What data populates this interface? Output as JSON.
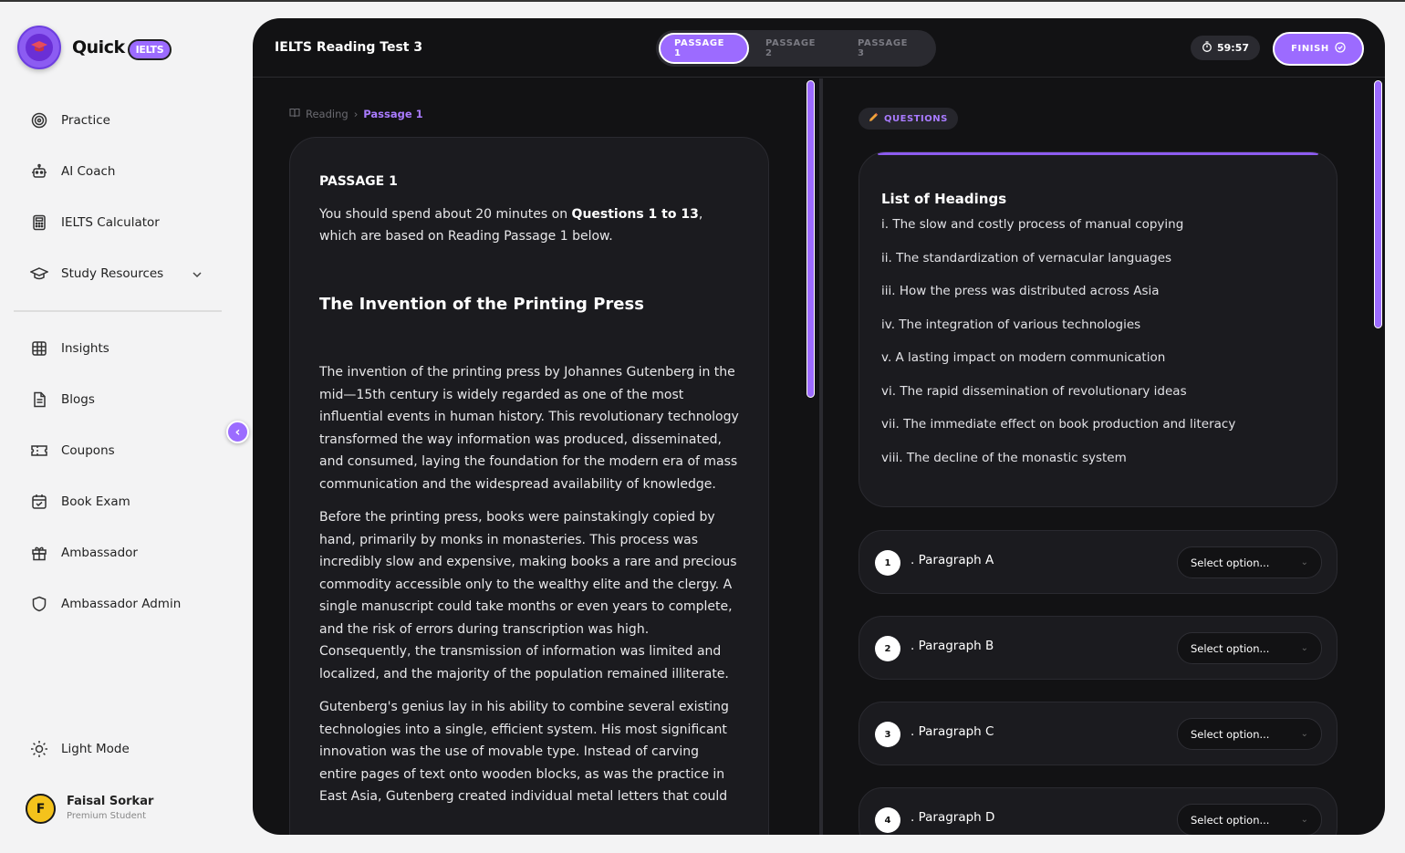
{
  "brand": {
    "name": "Quick",
    "badge": "IELTS"
  },
  "sidebar": {
    "items": [
      {
        "label": "Practice",
        "icon": "target-icon"
      },
      {
        "label": "AI Coach",
        "icon": "robot-icon"
      },
      {
        "label": "IELTS Calculator",
        "icon": "calculator-icon"
      },
      {
        "label": "Study Resources",
        "icon": "graduation-cap-icon"
      },
      {
        "label": "Insights",
        "icon": "grid-icon"
      },
      {
        "label": "Blogs",
        "icon": "document-icon"
      },
      {
        "label": "Coupons",
        "icon": "ticket-icon"
      },
      {
        "label": "Book Exam",
        "icon": "calendar-check-icon"
      },
      {
        "label": "Ambassador",
        "icon": "gift-icon"
      },
      {
        "label": "Ambassador Admin",
        "icon": "shield-icon"
      }
    ],
    "light_mode": "Light Mode",
    "user": {
      "initial": "F",
      "name": "Faisal Sorkar",
      "role": "Premium Student"
    }
  },
  "topbar": {
    "title": "IELTS Reading Test 3",
    "tabs": [
      "PASSAGE 1",
      "PASSAGE 2",
      "PASSAGE 3"
    ],
    "active_tab": 0,
    "timer": "59:57",
    "finish": "FINISH"
  },
  "breadcrumb": {
    "root": "Reading",
    "current": "Passage 1"
  },
  "passage": {
    "label": "PASSAGE 1",
    "intro_pre": "You should spend about 20 minutes on ",
    "intro_bold": "Questions 1 to 13",
    "intro_post": ", which are based on Reading Passage 1 below.",
    "heading": "The Invention of the Printing Press",
    "paragraphs": [
      "The invention of the printing press by Johannes Gutenberg in the mid—15th century is widely regarded as one of the most influential events in human history. This revolutionary technology transformed the way information was produced, disseminated, and consumed, laying the foundation for the modern era of mass communication and the widespread availability of knowledge.",
      "Before the printing press, books were painstakingly copied by hand, primarily by monks in monasteries. This process was incredibly slow and expensive, making books a rare and precious commodity accessible only to the wealthy elite and the clergy. A single manuscript could take months or even years to complete, and the risk of errors during transcription was high. Consequently, the transmission of information was limited and localized, and the majority of the population remained illiterate.",
      "Gutenberg's genius lay in his ability to combine several existing technologies into a single, efficient system. His most significant innovation was the use of movable type. Instead of carving entire pages of text onto wooden blocks, as was the practice in East Asia, Gutenberg created individual metal letters that could"
    ]
  },
  "questions": {
    "chip": "QUESTIONS",
    "headings_title": "List of Headings",
    "headings": [
      "i. The slow and costly process of manual copying",
      "ii. The standardization of vernacular languages",
      "iii. How the press was distributed across Asia",
      "iv. The integration of various technologies",
      "v. A lasting impact on modern communication",
      "vi. The rapid dissemination of revolutionary ideas",
      "vii. The immediate effect on book production and literacy",
      "viii. The decline of the monastic system"
    ],
    "items": [
      {
        "num": "1",
        "label": ". Paragraph A",
        "select": "Select option..."
      },
      {
        "num": "2",
        "label": ". Paragraph B",
        "select": "Select option..."
      },
      {
        "num": "3",
        "label": ". Paragraph C",
        "select": "Select option..."
      },
      {
        "num": "4",
        "label": ". Paragraph D",
        "select": "Select option..."
      }
    ]
  },
  "colors": {
    "accent": "#9c6bff",
    "panel": "#121214",
    "card": "#1b1b1f"
  }
}
